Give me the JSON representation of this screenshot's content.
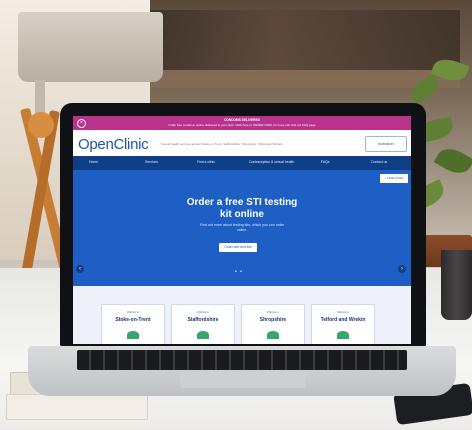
{
  "promo": {
    "title": "CONDOMS DELIVERED",
    "text": "Order free condoms online delivered to your door. Click here to ORDER NOW, for more info visit our FAQ page",
    "close": "×"
  },
  "header": {
    "logo": "OpenClinic",
    "tagline": "Sexual health services across Stoke-on-Trent, Staffordshire, Shropshire, Telford and Wrekin",
    "badge": "inclusion"
  },
  "nav": {
    "items": [
      "Home",
      "Services",
      "Find a clinic",
      "Contraception & sexual health",
      "FAQs",
      "Contact us"
    ]
  },
  "hero": {
    "corner_label": "+ HIDE PAGE",
    "title_line1": "Order a free STI testing",
    "title_line2": "kit online",
    "subtitle_line1": "Find out more about testing kits, which you can order",
    "subtitle_line2": "online.",
    "cta": "Order self-test kits",
    "prev": "‹",
    "next": "›",
    "dots": "• •"
  },
  "cards": [
    {
      "pre": "Clinics in",
      "name": "Stoke-on-Trent"
    },
    {
      "pre": "Clinics in",
      "name": "Staffordshire"
    },
    {
      "pre": "Clinics in",
      "name": "Shropshire"
    },
    {
      "pre": "Clinics in",
      "name": "Telford and Wrekin"
    }
  ]
}
